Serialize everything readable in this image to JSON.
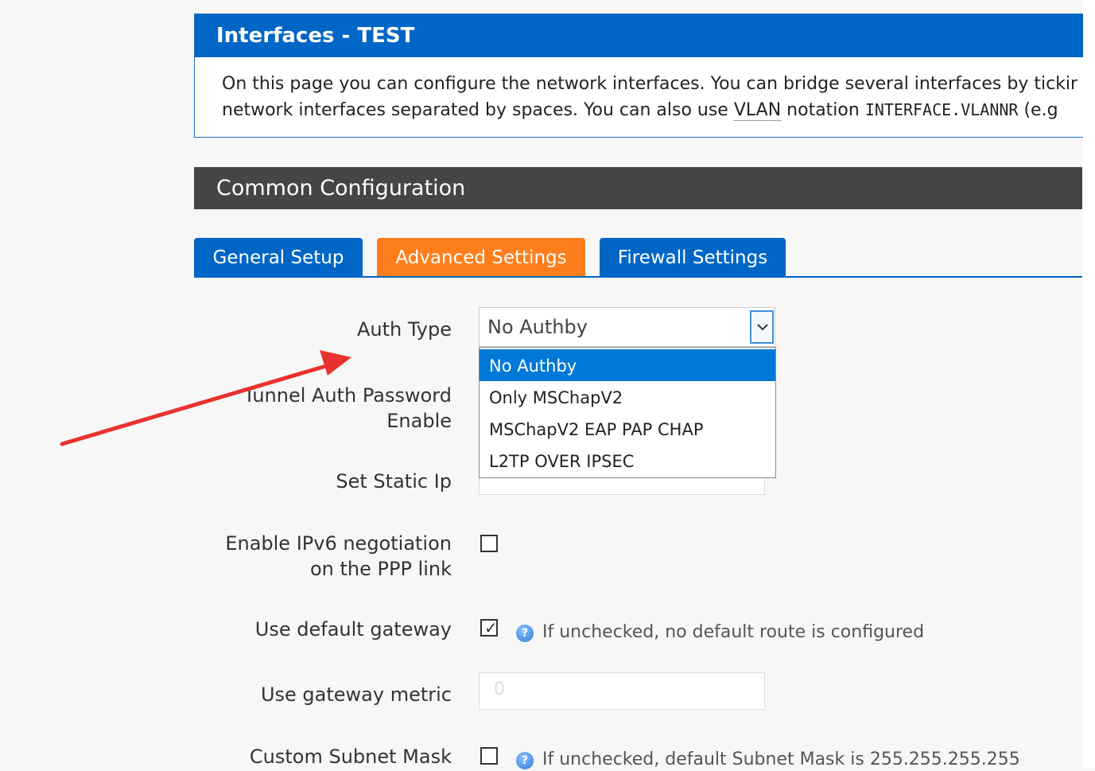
{
  "header": {
    "title": "Interfaces - TEST",
    "desc_line1": "On this page you can configure the network interfaces. You can bridge several interfaces by tickir",
    "desc_line2_pre": "network interfaces separated by spaces. You can also use ",
    "desc_line2_abbr": "VLAN",
    "desc_line2_mid": " notation ",
    "desc_line2_code": "INTERFACE.VLANNR",
    "desc_line2_post": " (e.g"
  },
  "section": {
    "title": "Common Configuration"
  },
  "tabs": [
    {
      "label": "General Setup",
      "active": false
    },
    {
      "label": "Advanced Settings",
      "active": true
    },
    {
      "label": "Firewall Settings",
      "active": false
    }
  ],
  "form": {
    "auth_type": {
      "label": "Auth Type",
      "value": "No Authby",
      "options": [
        "No Authby",
        "Only MSChapV2",
        "MSChapV2 EAP PAP CHAP",
        "L2TP OVER IPSEC"
      ],
      "selected_index": 0
    },
    "tunnel_auth": {
      "label_line1": "Tunnel Auth Password",
      "label_line2": "Enable"
    },
    "static_ip": {
      "label": "Set Static Ip"
    },
    "ipv6": {
      "label_line1": "Enable IPv6 negotiation",
      "label_line2": "on the PPP link",
      "checked": false
    },
    "default_gateway": {
      "label": "Use default gateway",
      "checked": true,
      "help": "If unchecked, no default route is configured"
    },
    "gateway_metric": {
      "label": "Use gateway metric",
      "placeholder": "0"
    },
    "subnet_mask": {
      "label": "Custom Subnet Mask",
      "checked": false,
      "help": "If unchecked, default Subnet Mask is 255.255.255.255"
    }
  },
  "colors": {
    "brand_blue": "#0066c6",
    "tab_active_orange": "#ff7e1c",
    "section_bar": "#454545",
    "dropdown_selected": "#0078d7",
    "annotation_arrow": "#e8322e"
  }
}
